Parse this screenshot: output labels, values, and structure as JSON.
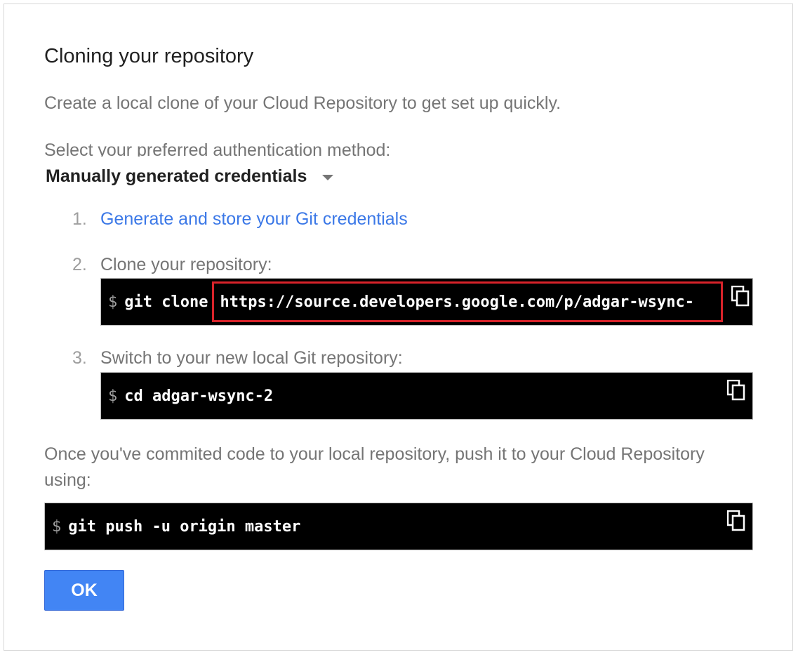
{
  "dialog": {
    "title": "Cloning your repository",
    "intro": "Create a local clone of your Cloud Repository to get set up quickly.",
    "auth_label": "Select your preferred authentication method:",
    "auth_selected": "Manually generated credentials"
  },
  "steps": [
    {
      "number": "1.",
      "link_text": "Generate and store your Git credentials"
    },
    {
      "number": "2.",
      "text": "Clone your repository:",
      "prompt": "$",
      "command": "git clone",
      "url": "https://source.developers.google.com/p/adgar-wsync-"
    },
    {
      "number": "3.",
      "text": "Switch to your new local Git repository:",
      "prompt": "$",
      "command": "cd adgar-wsync-2"
    }
  ],
  "push": {
    "text": "Once you've commited code to your local repository, push it to your Cloud Repository using:",
    "prompt": "$",
    "command": "git push -u origin master"
  },
  "ok_label": "OK",
  "colors": {
    "link": "#3b78e7",
    "button": "#4285f4",
    "highlight": "#d8232a",
    "code_bg": "#000000"
  }
}
